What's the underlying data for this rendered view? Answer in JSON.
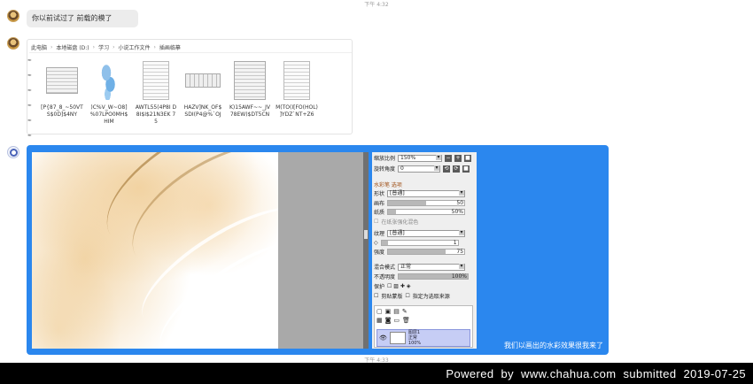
{
  "timestamps": {
    "top": "下午 4:32",
    "bottom": "下午 4:33"
  },
  "messages": {
    "text_message": "你以前试过了 前载的模了",
    "file_window": {
      "breadcrumb": [
        "此电脑",
        "本地磁盘 (D:)",
        "学习",
        "小说工作文件",
        "插画临摹"
      ],
      "files": [
        {
          "name": "[P{87_8_~50VT S$0D]$4NY",
          "kind": "doc"
        },
        {
          "name": ")C%V_W~O8] %07LPO0MH$ HIM",
          "kind": "blue"
        },
        {
          "name": "AWTL55(4P8I D8I$I$21N3EK 75",
          "kind": "doc"
        },
        {
          "name": "HAZV]NK_OF$ SDI(P4@%`OJ",
          "kind": "wide"
        },
        {
          "name": "K)15AWF~~_JV 78EW)$DT5CN",
          "kind": "panel"
        },
        {
          "name": "M(TO(I[FO(HOL) ]YDZ`NT+Z6",
          "kind": "doc"
        }
      ]
    },
    "image_message": {
      "caption": "我们以画出的水彩效果很我来了",
      "panel": {
        "zoom_label": "缩放比例",
        "zoom_value": "150%",
        "rotate_label": "旋转角度",
        "rotate_value": "0",
        "brush_section": "水彩笔 选项",
        "shape_label": "形状",
        "shape_value": "[普通]",
        "size_label": "画布",
        "size_value": "50",
        "density_label": "纸质",
        "density_value": "50%",
        "blend_checkbox": "在纸张强化混色",
        "texture_label": "纹理",
        "texture_value": "[普通]",
        "texture_amount": "1",
        "strength_label": "强度",
        "strength_value": "75",
        "mode_label": "混合模式",
        "mode_value": "正常",
        "opacity_label": "不透明度",
        "opacity_value": "100%",
        "protect_label": "保护",
        "clip_label": "剪贴蒙版",
        "ref_label": "指定为选取来源",
        "layer_name": "图层1",
        "layer_mode": "正常",
        "layer_opacity": "100%"
      }
    }
  },
  "footer": {
    "text": "Powered by www.chahua.com submitted 2019-07-25"
  },
  "colors": {
    "accent": "#2b87ee",
    "footer_bg": "#000000",
    "bubble_bg": "#ececec"
  }
}
